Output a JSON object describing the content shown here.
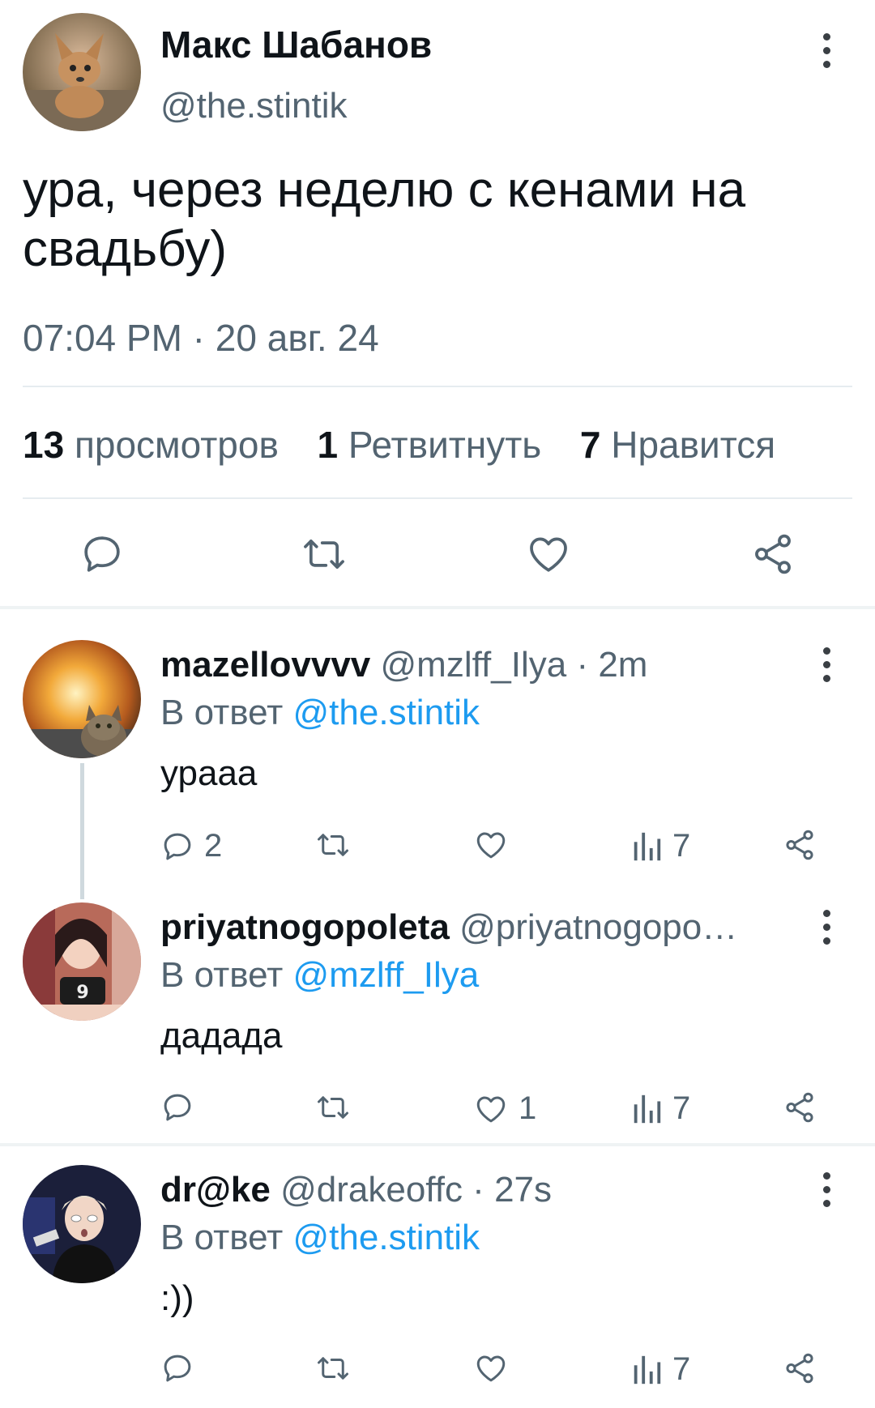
{
  "tweet": {
    "author_name": "Макс Шабанов",
    "author_handle": "@the.stintik",
    "text": "ура, через неделю с кенами на свадьбу)",
    "time": "07:04 PM",
    "date": "20 авг. 24",
    "date_sep": " · ",
    "stats": {
      "views_count": "13",
      "views_label": "просмотров",
      "retweets_count": "1",
      "retweets_label": "Ретвитнуть",
      "likes_count": "7",
      "likes_label": "Нравится"
    }
  },
  "replies": [
    {
      "name": "mazellovvvv",
      "handle": "@mzlff_Ilya",
      "time": "2m",
      "reply_prefix": "В ответ",
      "reply_to": "@the.stintik",
      "text": "урааа",
      "replies_count": "2",
      "retweets_count": "",
      "likes_count": "",
      "views_count": "7"
    },
    {
      "name": "priyatnogopoleta",
      "handle": "@priyatnogopo…",
      "time": "",
      "reply_prefix": "В ответ",
      "reply_to": "@mzlff_Ilya",
      "text": "дадада",
      "replies_count": "",
      "retweets_count": "",
      "likes_count": "1",
      "views_count": "7"
    },
    {
      "name": "dr@ke",
      "handle": "@drakeoffc",
      "time": "27s",
      "reply_prefix": "В ответ",
      "reply_to": "@the.stintik",
      "text": ":))",
      "replies_count": "",
      "retweets_count": "",
      "likes_count": "",
      "views_count": "7"
    }
  ],
  "colors": {
    "link": "#1d9bf0",
    "muted": "#536471",
    "text": "#0f1419"
  },
  "icons": [
    "reply-icon",
    "retweet-icon",
    "like-icon",
    "share-icon",
    "views-icon",
    "more-icon"
  ]
}
